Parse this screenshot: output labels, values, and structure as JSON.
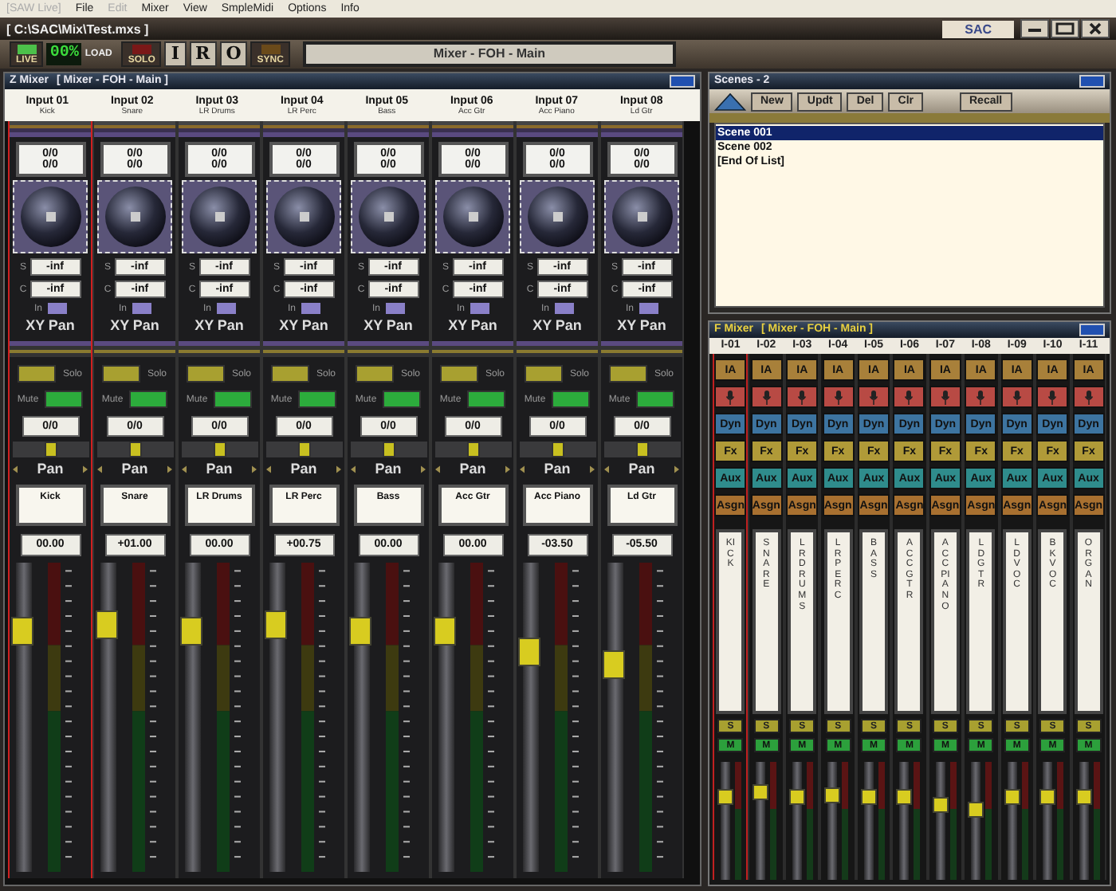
{
  "menu": [
    {
      "label": "[SAW Live]",
      "disabled": true
    },
    {
      "label": "File",
      "disabled": false
    },
    {
      "label": "Edit",
      "disabled": true
    },
    {
      "label": "Mixer",
      "disabled": false
    },
    {
      "label": "View",
      "disabled": false
    },
    {
      "label": "SmpleMidi",
      "disabled": false
    },
    {
      "label": "Options",
      "disabled": false
    },
    {
      "label": "Info",
      "disabled": false
    }
  ],
  "window": {
    "title": "[ C:\\SAC\\Mix\\Test.mxs ]",
    "logo": "SAC"
  },
  "toolbar": {
    "live_label": "LIVE",
    "load_value": "00%",
    "load_label": "LOAD",
    "solo_label": "SOLO",
    "io_buttons": [
      "I",
      "R",
      "O"
    ],
    "sync_label": "SYNC",
    "display": "Mixer - FOH - Main"
  },
  "z_mixer": {
    "title": "Z Mixer",
    "subtitle": "[ Mixer - FOH - Main ]",
    "channels": [
      {
        "input": "Input 01",
        "name": "Kick",
        "selected": true,
        "readout": [
          "0/0",
          "0/0"
        ],
        "sends": [
          {
            "label": "S",
            "value": "-inf"
          },
          {
            "label": "C",
            "value": "-inf"
          }
        ],
        "in_label": "In",
        "xy_label": "XY Pan",
        "solo_label": "Solo",
        "mute_label": "Mute",
        "pan_value": "0/0",
        "pan": {
          "level": 0.5
        },
        "pan_label": "Pan",
        "label": "Kick",
        "gain": "00.00",
        "fader": {
          "level": 0.78
        }
      },
      {
        "input": "Input 02",
        "name": "Snare",
        "selected": false,
        "readout": [
          "0/0",
          "0/0"
        ],
        "sends": [
          {
            "label": "S",
            "value": "-inf"
          },
          {
            "label": "C",
            "value": "-inf"
          }
        ],
        "in_label": "In",
        "xy_label": "XY Pan",
        "solo_label": "Solo",
        "mute_label": "Mute",
        "pan_value": "0/0",
        "pan": {
          "level": 0.5
        },
        "pan_label": "Pan",
        "label": "Snare",
        "gain": "+01.00",
        "fader": {
          "level": 0.8
        }
      },
      {
        "input": "Input 03",
        "name": "LR Drums",
        "selected": false,
        "readout": [
          "0/0",
          "0/0"
        ],
        "sends": [
          {
            "label": "S",
            "value": "-inf"
          },
          {
            "label": "C",
            "value": "-inf"
          }
        ],
        "in_label": "In",
        "xy_label": "XY Pan",
        "solo_label": "Solo",
        "mute_label": "Mute",
        "pan_value": "0/0",
        "pan": {
          "level": 0.5
        },
        "pan_label": "Pan",
        "label": "LR Drums",
        "gain": "00.00",
        "fader": {
          "level": 0.78
        }
      },
      {
        "input": "Input 04",
        "name": "LR Perc",
        "selected": false,
        "readout": [
          "0/0",
          "0/0"
        ],
        "sends": [
          {
            "label": "S",
            "value": "-inf"
          },
          {
            "label": "C",
            "value": "-inf"
          }
        ],
        "in_label": "In",
        "xy_label": "XY Pan",
        "solo_label": "Solo",
        "mute_label": "Mute",
        "pan_value": "0/0",
        "pan": {
          "level": 0.5
        },
        "pan_label": "Pan",
        "label": "LR Perc",
        "gain": "+00.75",
        "fader": {
          "level": 0.8
        }
      },
      {
        "input": "Input 05",
        "name": "Bass",
        "selected": false,
        "readout": [
          "0/0",
          "0/0"
        ],
        "sends": [
          {
            "label": "S",
            "value": "-inf"
          },
          {
            "label": "C",
            "value": "-inf"
          }
        ],
        "in_label": "In",
        "xy_label": "XY Pan",
        "solo_label": "Solo",
        "mute_label": "Mute",
        "pan_value": "0/0",
        "pan": {
          "level": 0.5
        },
        "pan_label": "Pan",
        "label": "Bass",
        "gain": "00.00",
        "fader": {
          "level": 0.78
        }
      },
      {
        "input": "Input 06",
        "name": "Acc Gtr",
        "selected": false,
        "readout": [
          "0/0",
          "0/0"
        ],
        "sends": [
          {
            "label": "S",
            "value": "-inf"
          },
          {
            "label": "C",
            "value": "-inf"
          }
        ],
        "in_label": "In",
        "xy_label": "XY Pan",
        "solo_label": "Solo",
        "mute_label": "Mute",
        "pan_value": "0/0",
        "pan": {
          "level": 0.5
        },
        "pan_label": "Pan",
        "label": "Acc Gtr",
        "gain": "00.00",
        "fader": {
          "level": 0.78
        }
      },
      {
        "input": "Input 07",
        "name": "Acc Piano",
        "selected": false,
        "readout": [
          "0/0",
          "0/0"
        ],
        "sends": [
          {
            "label": "S",
            "value": "-inf"
          },
          {
            "label": "C",
            "value": "-inf"
          }
        ],
        "in_label": "In",
        "xy_label": "XY Pan",
        "solo_label": "Solo",
        "mute_label": "Mute",
        "pan_value": "0/0",
        "pan": {
          "level": 0.5
        },
        "pan_label": "Pan",
        "label": "Acc Piano",
        "gain": "-03.50",
        "fader": {
          "level": 0.71
        }
      },
      {
        "input": "Input 08",
        "name": "Ld Gtr",
        "selected": false,
        "readout": [
          "0/0",
          "0/0"
        ],
        "sends": [
          {
            "label": "S",
            "value": "-inf"
          },
          {
            "label": "C",
            "value": "-inf"
          }
        ],
        "in_label": "In",
        "xy_label": "XY Pan",
        "solo_label": "Solo",
        "mute_label": "Mute",
        "pan_value": "0/0",
        "pan": {
          "level": 0.5
        },
        "pan_label": "Pan",
        "label": "Ld Gtr",
        "gain": "-05.50",
        "fader": {
          "level": 0.67
        }
      }
    ]
  },
  "scenes": {
    "title": "Scenes - 2",
    "buttons": [
      "New",
      "Updt",
      "Del",
      "Clr"
    ],
    "recall": "Recall",
    "items": [
      {
        "label": "Scene 001",
        "selected": true
      },
      {
        "label": "Scene 002",
        "selected": false
      },
      {
        "label": "[End Of List]",
        "selected": false
      }
    ]
  },
  "f_mixer": {
    "title": "F Mixer",
    "subtitle": "[ Mixer - FOH - Main ]",
    "channels": [
      {
        "header": "I-01",
        "selected": true,
        "buttons": [
          {
            "kind": "text",
            "label": "IA",
            "color": "#a8803a"
          },
          {
            "kind": "icon",
            "color": "#b84a44"
          },
          {
            "kind": "text",
            "label": "Dyn",
            "color": "#3d74a0"
          },
          {
            "kind": "text",
            "label": "Fx",
            "color": "#b09a38"
          },
          {
            "kind": "text",
            "label": "Aux",
            "color": "#2f8c8c"
          },
          {
            "kind": "text",
            "label": "Asgn",
            "color": "#a87030"
          }
        ],
        "name": "KICK",
        "solo_label": "S",
        "mute_label": "M",
        "fader": {
          "level": 0.7
        }
      },
      {
        "header": "I-02",
        "selected": false,
        "buttons": [
          {
            "kind": "text",
            "label": "IA",
            "color": "#a8803a"
          },
          {
            "kind": "icon",
            "color": "#b84a44"
          },
          {
            "kind": "text",
            "label": "Dyn",
            "color": "#3d74a0"
          },
          {
            "kind": "text",
            "label": "Fx",
            "color": "#b09a38"
          },
          {
            "kind": "text",
            "label": "Aux",
            "color": "#2f8c8c"
          },
          {
            "kind": "text",
            "label": "Asgn",
            "color": "#a87030"
          }
        ],
        "name": "SNARE",
        "solo_label": "S",
        "mute_label": "M",
        "fader": {
          "level": 0.74
        }
      },
      {
        "header": "I-03",
        "selected": false,
        "buttons": [
          {
            "kind": "text",
            "label": "IA",
            "color": "#a8803a"
          },
          {
            "kind": "icon",
            "color": "#b84a44"
          },
          {
            "kind": "text",
            "label": "Dyn",
            "color": "#3d74a0"
          },
          {
            "kind": "text",
            "label": "Fx",
            "color": "#b09a38"
          },
          {
            "kind": "text",
            "label": "Aux",
            "color": "#2f8c8c"
          },
          {
            "kind": "text",
            "label": "Asgn",
            "color": "#a87030"
          }
        ],
        "name": "LR DRUMS",
        "solo_label": "S",
        "mute_label": "M",
        "fader": {
          "level": 0.7
        }
      },
      {
        "header": "I-04",
        "selected": false,
        "buttons": [
          {
            "kind": "text",
            "label": "IA",
            "color": "#a8803a"
          },
          {
            "kind": "icon",
            "color": "#b84a44"
          },
          {
            "kind": "text",
            "label": "Dyn",
            "color": "#3d74a0"
          },
          {
            "kind": "text",
            "label": "Fx",
            "color": "#b09a38"
          },
          {
            "kind": "text",
            "label": "Aux",
            "color": "#2f8c8c"
          },
          {
            "kind": "text",
            "label": "Asgn",
            "color": "#a87030"
          }
        ],
        "name": "LR PERC",
        "solo_label": "S",
        "mute_label": "M",
        "fader": {
          "level": 0.72
        }
      },
      {
        "header": "I-05",
        "selected": false,
        "buttons": [
          {
            "kind": "text",
            "label": "IA",
            "color": "#a8803a"
          },
          {
            "kind": "icon",
            "color": "#b84a44"
          },
          {
            "kind": "text",
            "label": "Dyn",
            "color": "#3d74a0"
          },
          {
            "kind": "text",
            "label": "Fx",
            "color": "#b09a38"
          },
          {
            "kind": "text",
            "label": "Aux",
            "color": "#2f8c8c"
          },
          {
            "kind": "text",
            "label": "Asgn",
            "color": "#a87030"
          }
        ],
        "name": "BASS",
        "solo_label": "S",
        "mute_label": "M",
        "fader": {
          "level": 0.7
        }
      },
      {
        "header": "I-06",
        "selected": false,
        "buttons": [
          {
            "kind": "text",
            "label": "IA",
            "color": "#a8803a"
          },
          {
            "kind": "icon",
            "color": "#b84a44"
          },
          {
            "kind": "text",
            "label": "Dyn",
            "color": "#3d74a0"
          },
          {
            "kind": "text",
            "label": "Fx",
            "color": "#b09a38"
          },
          {
            "kind": "text",
            "label": "Aux",
            "color": "#2f8c8c"
          },
          {
            "kind": "text",
            "label": "Asgn",
            "color": "#a87030"
          }
        ],
        "name": "ACC GTR",
        "solo_label": "S",
        "mute_label": "M",
        "fader": {
          "level": 0.7
        }
      },
      {
        "header": "I-07",
        "selected": false,
        "buttons": [
          {
            "kind": "text",
            "label": "IA",
            "color": "#a8803a"
          },
          {
            "kind": "icon",
            "color": "#b84a44"
          },
          {
            "kind": "text",
            "label": "Dyn",
            "color": "#3d74a0"
          },
          {
            "kind": "text",
            "label": "Fx",
            "color": "#b09a38"
          },
          {
            "kind": "text",
            "label": "Aux",
            "color": "#2f8c8c"
          },
          {
            "kind": "text",
            "label": "Asgn",
            "color": "#a87030"
          }
        ],
        "name": "ACC PIANO",
        "solo_label": "S",
        "mute_label": "M",
        "fader": {
          "level": 0.64
        }
      },
      {
        "header": "I-08",
        "selected": false,
        "buttons": [
          {
            "kind": "text",
            "label": "IA",
            "color": "#a8803a"
          },
          {
            "kind": "icon",
            "color": "#b84a44"
          },
          {
            "kind": "text",
            "label": "Dyn",
            "color": "#3d74a0"
          },
          {
            "kind": "text",
            "label": "Fx",
            "color": "#b09a38"
          },
          {
            "kind": "text",
            "label": "Aux",
            "color": "#2f8c8c"
          },
          {
            "kind": "text",
            "label": "Asgn",
            "color": "#a87030"
          }
        ],
        "name": "LD GTR",
        "solo_label": "S",
        "mute_label": "M",
        "fader": {
          "level": 0.6
        }
      },
      {
        "header": "I-09",
        "selected": false,
        "buttons": [
          {
            "kind": "text",
            "label": "IA",
            "color": "#a8803a"
          },
          {
            "kind": "icon",
            "color": "#b84a44"
          },
          {
            "kind": "text",
            "label": "Dyn",
            "color": "#3d74a0"
          },
          {
            "kind": "text",
            "label": "Fx",
            "color": "#b09a38"
          },
          {
            "kind": "text",
            "label": "Aux",
            "color": "#2f8c8c"
          },
          {
            "kind": "text",
            "label": "Asgn",
            "color": "#a87030"
          }
        ],
        "name": "LD VOC",
        "solo_label": "S",
        "mute_label": "M",
        "fader": {
          "level": 0.7
        }
      },
      {
        "header": "I-10",
        "selected": false,
        "buttons": [
          {
            "kind": "text",
            "label": "IA",
            "color": "#a8803a"
          },
          {
            "kind": "icon",
            "color": "#b84a44"
          },
          {
            "kind": "text",
            "label": "Dyn",
            "color": "#3d74a0"
          },
          {
            "kind": "text",
            "label": "Fx",
            "color": "#b09a38"
          },
          {
            "kind": "text",
            "label": "Aux",
            "color": "#2f8c8c"
          },
          {
            "kind": "text",
            "label": "Asgn",
            "color": "#a87030"
          }
        ],
        "name": "BK VOC",
        "solo_label": "S",
        "mute_label": "M",
        "fader": {
          "level": 0.7
        }
      },
      {
        "header": "I-11",
        "selected": false,
        "buttons": [
          {
            "kind": "text",
            "label": "IA",
            "color": "#a8803a"
          },
          {
            "kind": "icon",
            "color": "#b84a44"
          },
          {
            "kind": "text",
            "label": "Dyn",
            "color": "#3d74a0"
          },
          {
            "kind": "text",
            "label": "Fx",
            "color": "#b09a38"
          },
          {
            "kind": "text",
            "label": "Aux",
            "color": "#2f8c8c"
          },
          {
            "kind": "text",
            "label": "Asgn",
            "color": "#a87030"
          }
        ],
        "name": "ORGAN",
        "solo_label": "S",
        "mute_label": "M",
        "fader": {
          "level": 0.7
        }
      }
    ]
  }
}
